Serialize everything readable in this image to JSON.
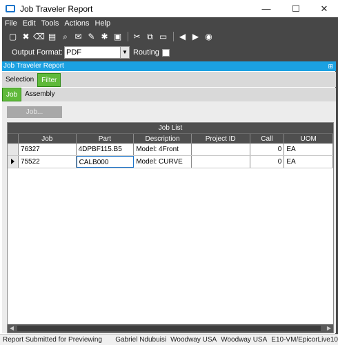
{
  "window": {
    "title": "Job Traveler Report",
    "minimize": "—",
    "maximize": "☐",
    "close": "✕"
  },
  "menu": [
    "File",
    "Edit",
    "Tools",
    "Actions",
    "Help"
  ],
  "toolbar_icons": [
    "new-icon",
    "delete-icon",
    "clear-icon",
    "print-icon",
    "print-preview-icon",
    "send-icon",
    "attach-icon",
    "tools-icon",
    "screen-icon",
    "cut-icon",
    "copy-icon",
    "paste-icon",
    "back-icon",
    "forward-icon",
    "home-icon"
  ],
  "output": {
    "label": "Output Format:",
    "value": "PDF",
    "routing_label": "Routing"
  },
  "panel": {
    "title": "Job Traveler Report",
    "pin": "⊞"
  },
  "tabs": {
    "selection": "Selection",
    "filter": "Filter"
  },
  "subtabs": {
    "job": "Job",
    "assembly": "Assembly"
  },
  "job_button": "Job...",
  "grid": {
    "caption": "Job List",
    "columns": [
      "Job",
      "Part",
      "Description",
      "Project ID",
      "Call",
      "UOM"
    ],
    "rows": [
      {
        "job": "76327",
        "part": "4DPBF115.B5",
        "description": "Model:  4Front",
        "project": "",
        "call": "0",
        "uom": "EA"
      },
      {
        "job": "75522",
        "part": "CALB000",
        "description": "Model:  CURVE",
        "project": "",
        "call": "0",
        "uom": "EA"
      }
    ]
  },
  "status": {
    "message": "Report Submitted for Previewing",
    "user": "Gabriel Ndubuisi",
    "company": "Woodway USA",
    "site": "Woodway USA",
    "server": "E10-VM/EpicorLive10"
  }
}
